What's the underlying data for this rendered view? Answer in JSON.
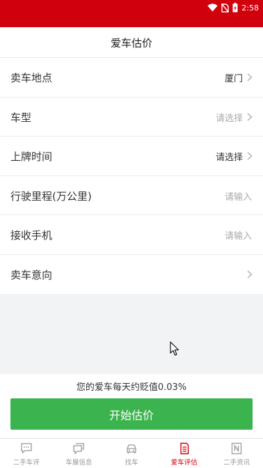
{
  "status_bar": {
    "time": "2:58",
    "icons": [
      "wifi-icon",
      "no-sim-icon",
      "battery-charging-icon"
    ]
  },
  "header": {
    "title": "爱车估价"
  },
  "form": {
    "rows": [
      {
        "label": "卖车地点",
        "value": "厦门",
        "placeholder": false,
        "has_arrow": true
      },
      {
        "label": "车型",
        "value": "请选择",
        "placeholder": true,
        "has_arrow": true
      },
      {
        "label": "上牌时间",
        "value": "请选择",
        "placeholder": false,
        "has_arrow": true
      },
      {
        "label": "行驶里程(万公里)",
        "value": "请输入",
        "placeholder": true,
        "has_arrow": false
      },
      {
        "label": "接收手机",
        "value": "请输入",
        "placeholder": true,
        "has_arrow": false
      },
      {
        "label": "卖车意向",
        "value": "",
        "placeholder": false,
        "has_arrow": true
      }
    ]
  },
  "footer": {
    "note": "您的爱车每天约贬值0.03%",
    "button_label": "开始估价"
  },
  "tabs": [
    {
      "label": "二手车评",
      "icon": "chat-icon",
      "active": false
    },
    {
      "label": "车展信息",
      "icon": "message-icon",
      "active": false
    },
    {
      "label": "找车",
      "icon": "car-icon",
      "active": false
    },
    {
      "label": "爱车评估",
      "icon": "document-icon",
      "active": true
    },
    {
      "label": "二手资讯",
      "icon": "news-icon",
      "active": false
    }
  ],
  "colors": {
    "brand_red": "#d0000c",
    "button_green": "#3bb44f",
    "placeholder": "#aaaaaa"
  }
}
